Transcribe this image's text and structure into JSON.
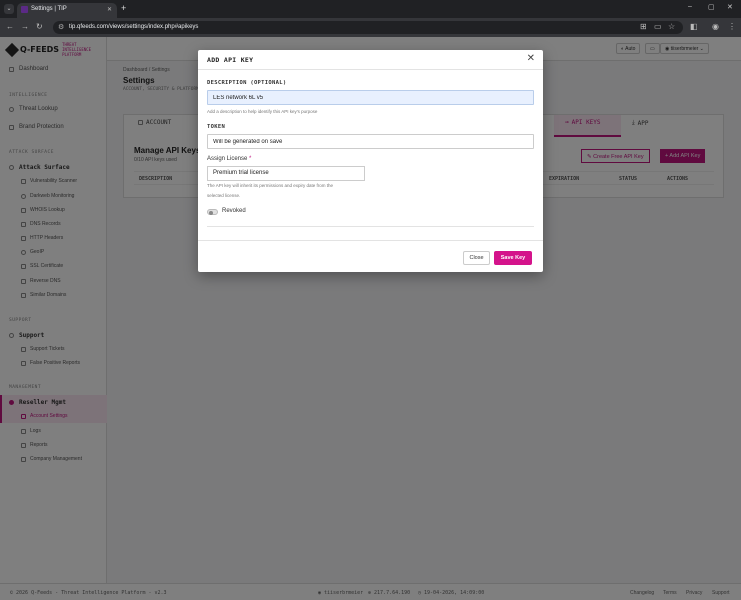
{
  "browser": {
    "tab_title": "Settings | TIP",
    "url": "tip.qfeeds.com/views/settings/index.php#apikeys"
  },
  "app": {
    "logo_text": "Q-FEEDS",
    "logo_subtitle": "THREAT INTELLIGENCE PLATFORM",
    "header": {
      "theme_button": "Auto",
      "user_button": "tiiserbrmeier"
    },
    "sidebar": {
      "dashboard": "Dashboard",
      "intelligence_section": "INTELLIGENCE",
      "threat_lookup": "Threat Lookup",
      "brand_protection": "Brand Protection",
      "attack_surface_section": "ATTACK SURFACE",
      "attack_surface": "Attack Surface",
      "attack_items": [
        "Vulnerability Scanner",
        "Darkweb Monitoring",
        "WHOIS Lookup",
        "DNS Records",
        "HTTP Headers",
        "GeoIP",
        "SSL Certificate",
        "Reverse DNS",
        "Similar Domains"
      ],
      "support_section": "SUPPORT",
      "support": "Support",
      "support_items": [
        "Support Tickets",
        "False Positive Reports"
      ],
      "management_section": "MANAGEMENT",
      "reseller": "Reseller Mgmt",
      "reseller_items": [
        "Account Settings",
        "Logs",
        "Reports",
        "Company Management"
      ]
    },
    "breadcrumb": {
      "home": "Dashboard",
      "sep": "/",
      "current": "Settings"
    },
    "page_title": "Settings",
    "page_subtitle": "ACCOUNT, SECURITY & PLATFORM",
    "tabs": {
      "account": "ACCOUNT",
      "api_keys": "API KEYS",
      "app": "APP"
    },
    "api_card": {
      "title": "Manage API Keys",
      "subtitle": "0/10 API keys used",
      "create_free": "Create Free API Key",
      "add_key": "+ Add API Key",
      "columns": [
        "DESCRIPTION",
        "EXPIRATION",
        "STATUS",
        "ACTIONS"
      ]
    },
    "footer": {
      "copyright": "© 2026 Q-Feeds - Threat Intelligence Platform - v2.3",
      "user": "tiiserbrmeier",
      "ip": "217.7.64.190",
      "time": "19-04-2026, 14:09:00",
      "links": [
        "Changelog",
        "Terms",
        "Privacy",
        "Support"
      ]
    }
  },
  "modal": {
    "title": "ADD API KEY",
    "description_label": "DESCRIPTION (OPTIONAL)",
    "description_value": "LES network 6L v5",
    "description_help": "Add a description to help identify this API key's purpose",
    "token_label": "TOKEN",
    "token_placeholder": "Will be generated on save",
    "license_label": "Assign License",
    "license_required": "*",
    "license_value": "Premium trial license",
    "license_help_1": "The API key will inherit its permissions and expiry date from the",
    "license_help_2": "selected license.",
    "revoked_label": "Revoked",
    "close_button": "Close",
    "save_button": "Save Key"
  },
  "colors": {
    "accent": "#c0147f",
    "overlay": "rgba(0,0,0,0.5)"
  }
}
